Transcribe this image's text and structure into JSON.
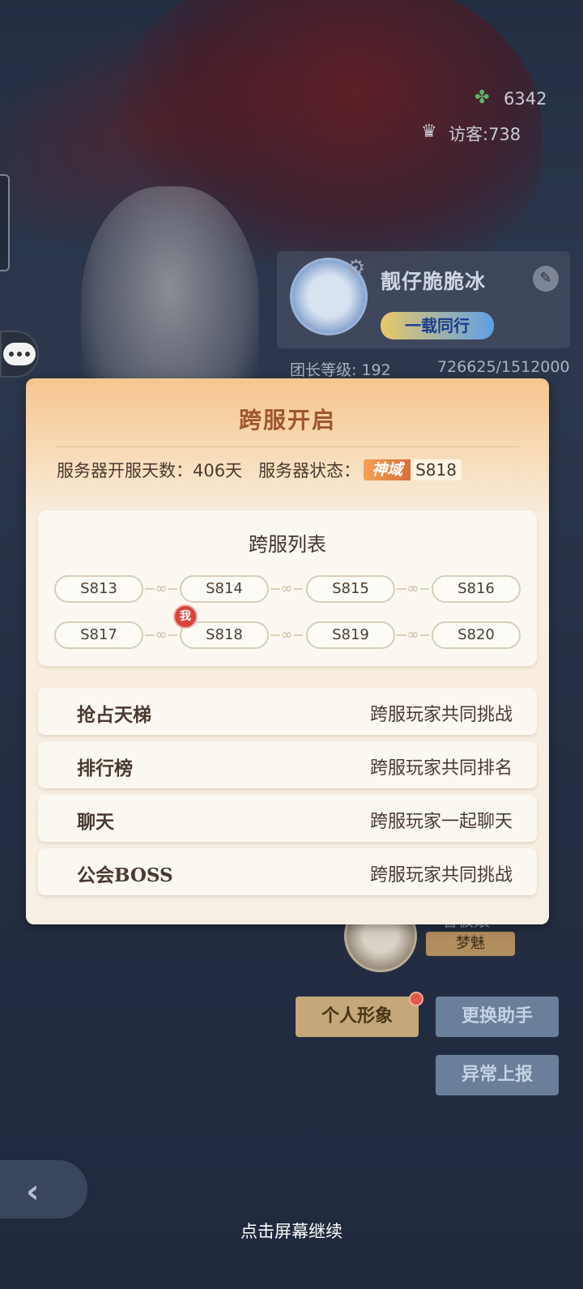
{
  "hud": {
    "clover_count": "6342",
    "visitors": "访客:738",
    "clover_icon": "clover-icon",
    "visitor_icon": "crown-icon"
  },
  "profile": {
    "name": "靓仔脆脆冰",
    "title_badge": "一载同行",
    "level": "团长等级: 192",
    "exp": "726625/1512000"
  },
  "partner": {
    "name": "看板娘",
    "tag": "梦魅"
  },
  "buttons": {
    "personal_image": "个人形象",
    "change_assistant": "更换助手",
    "report": "异常上报"
  },
  "footer": {
    "continue": "点击屏幕继续"
  },
  "panel": {
    "title": "跨服开启",
    "open_days_label": "服务器开服天数：",
    "open_days_value": "406天",
    "status_label": "服务器状态：",
    "realm_badge": "神域",
    "realm_server": "S818",
    "list_title": "跨服列表",
    "servers": [
      "S813",
      "S814",
      "S815",
      "S816",
      "S817",
      "S818",
      "S819",
      "S820"
    ],
    "me_marker": "我",
    "features": [
      {
        "name": "抢占天梯",
        "desc": "跨服玩家共同挑战"
      },
      {
        "name": "排行榜",
        "desc": "跨服玩家共同排名"
      },
      {
        "name": "聊天",
        "desc": "跨服玩家一起聊天"
      },
      {
        "name": "公会BOSS",
        "desc": "跨服玩家共同挑战"
      }
    ]
  },
  "colors": {
    "panel_title": "#a0562e",
    "realm_badge": "#e0803f",
    "me_marker": "#d8433b"
  }
}
